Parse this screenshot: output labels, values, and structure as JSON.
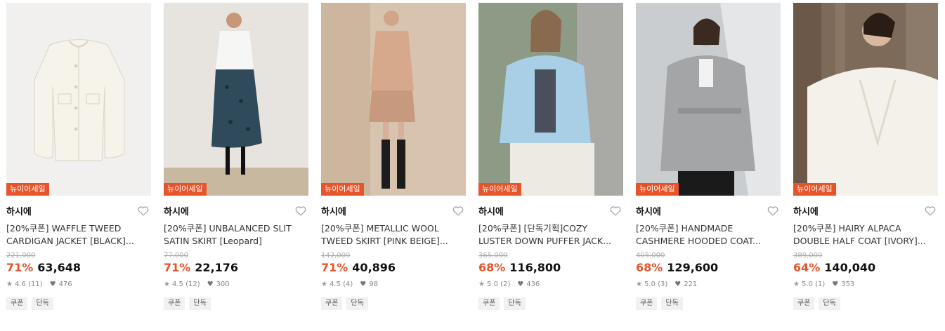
{
  "products": [
    {
      "badge": "뉴이어세일",
      "brand": "하시에",
      "title": "[20%쿠폰] WAFFLE TWEED CARDIGAN JACKET [BLACK]...",
      "original_price": "221,000",
      "discount": "71%",
      "price": "63,648",
      "rating": "4.6",
      "reviews": "(11)",
      "likes": "476",
      "tags": [
        "쿠폰",
        "단독"
      ],
      "icon": "heart-icon"
    },
    {
      "badge": "뉴이어세일",
      "brand": "하시에",
      "title": "[20%쿠폰] UNBALANCED SLIT SATIN SKIRT [Leopard]",
      "original_price": "77,000",
      "discount": "71%",
      "price": "22,176",
      "rating": "4.5",
      "reviews": "(12)",
      "likes": "300",
      "tags": [
        "쿠폰",
        "단독"
      ],
      "icon": "heart-icon"
    },
    {
      "badge": "뉴이어세일",
      "brand": "하시에",
      "title": "[20%쿠폰] METALLIC WOOL TWEED SKIRT [PINK BEIGE]...",
      "original_price": "142,000",
      "discount": "71%",
      "price": "40,896",
      "rating": "4.5",
      "reviews": "(4)",
      "likes": "98",
      "tags": [
        "쿠폰",
        "단독"
      ],
      "icon": "heart-icon"
    },
    {
      "badge": "뉴이어세일",
      "brand": "하시에",
      "title": "[20%쿠폰] [단독기획]COZY LUSTER DOWN PUFFER JACK...",
      "original_price": "365,000",
      "discount": "68%",
      "price": "116,800",
      "rating": "5.0",
      "reviews": "(2)",
      "likes": "436",
      "tags": [
        "쿠폰",
        "단독"
      ],
      "icon": "heart-icon"
    },
    {
      "badge": "뉴이어세일",
      "brand": "하시에",
      "title": "[20%쿠폰] HANDMADE CASHMERE HOODED COAT...",
      "original_price": "405,000",
      "discount": "68%",
      "price": "129,600",
      "rating": "5.0",
      "reviews": "(3)",
      "likes": "221",
      "tags": [
        "쿠폰",
        "단독"
      ],
      "icon": "heart-icon"
    },
    {
      "badge": "뉴이어세일",
      "brand": "하시에",
      "title": "[20%쿠폰] HAIRY ALPACA DOUBLE HALF COAT [IVORY]...",
      "original_price": "389,000",
      "discount": "64%",
      "price": "140,040",
      "rating": "5.0",
      "reviews": "(1)",
      "likes": "353",
      "tags": [
        "쿠폰",
        "단독"
      ],
      "icon": "heart-icon"
    }
  ],
  "colors": {
    "accent": "#e8542a",
    "badge_bg": "#e8542a"
  }
}
